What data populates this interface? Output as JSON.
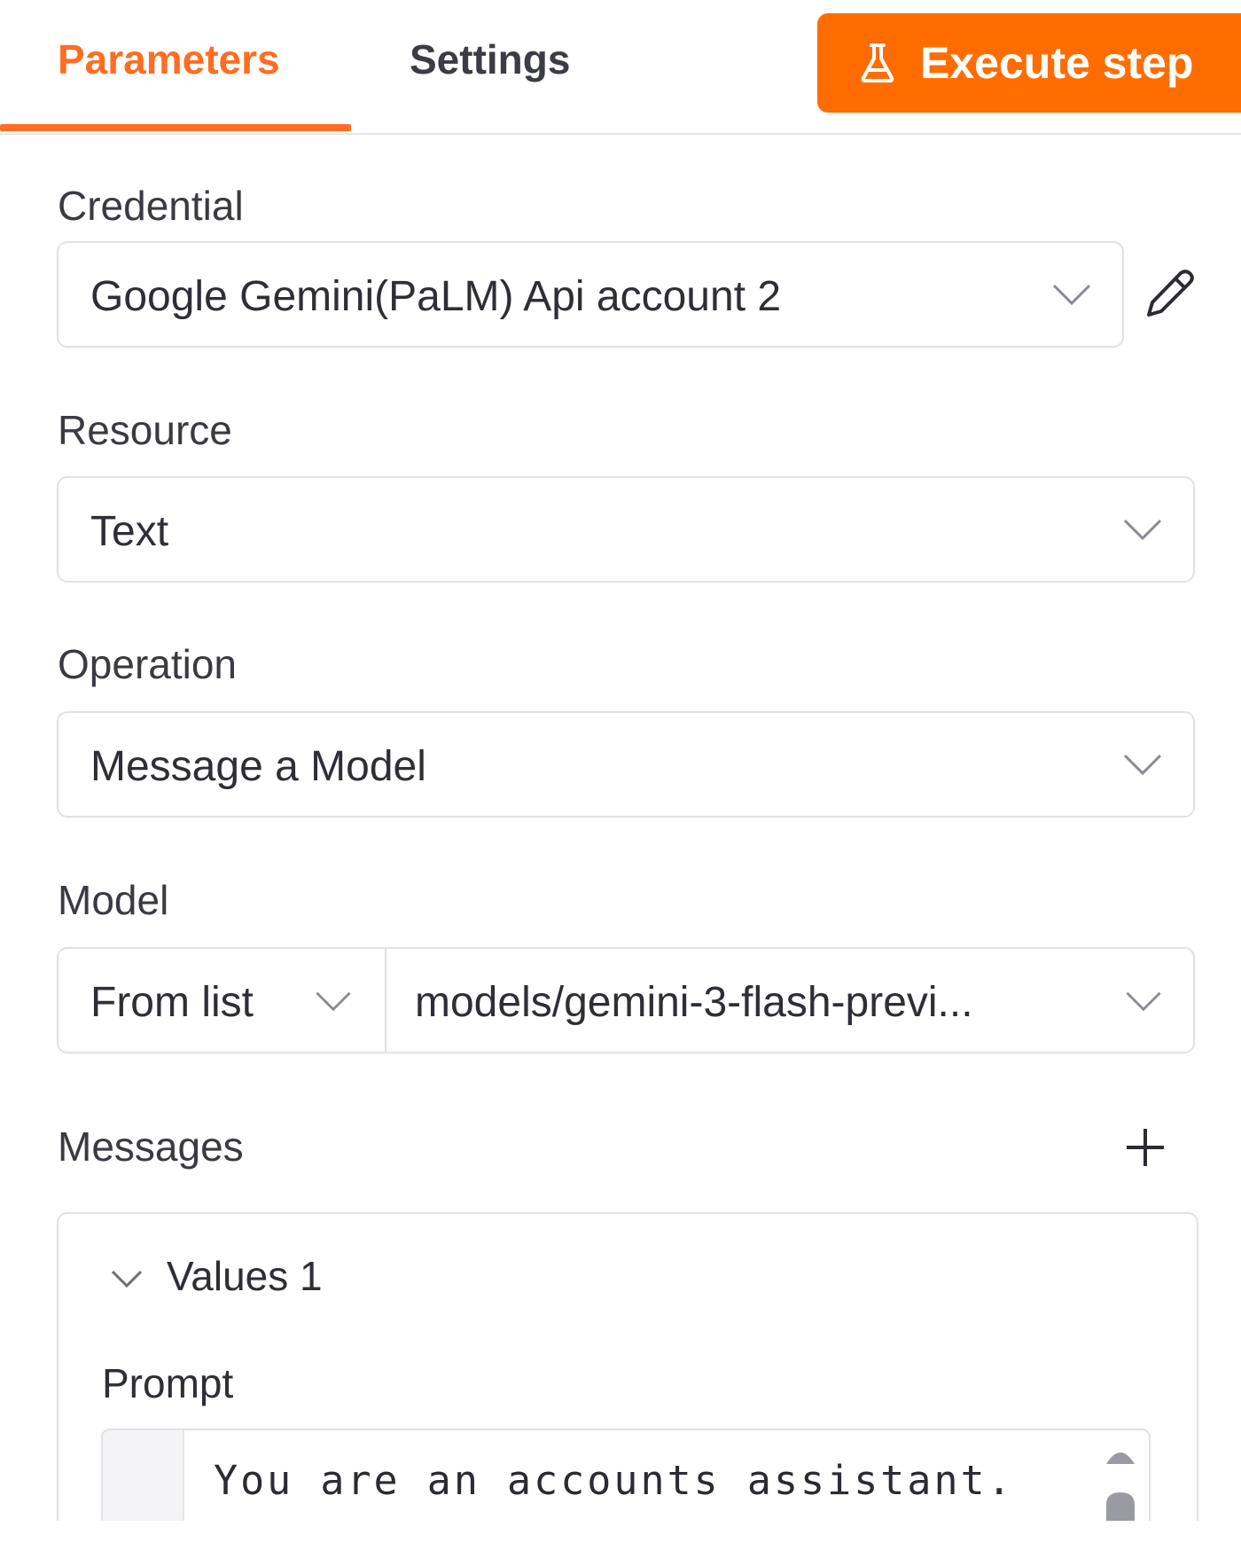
{
  "header": {
    "tabs": [
      {
        "label": "Parameters",
        "active": true
      },
      {
        "label": "Settings",
        "active": false
      }
    ],
    "execute_label": "Execute step"
  },
  "fields": {
    "credential": {
      "label": "Credential",
      "value": "Google Gemini(PaLM) Api account 2"
    },
    "resource": {
      "label": "Resource",
      "value": "Text"
    },
    "operation": {
      "label": "Operation",
      "value": "Message a Model"
    },
    "model": {
      "label": "Model",
      "mode": "From list",
      "value": "models/gemini-3-flash-previ..."
    }
  },
  "messages": {
    "label": "Messages",
    "group_title": "Values 1",
    "prompt_label": "Prompt",
    "prompt_text": "You are an accounts assistant."
  },
  "colors": {
    "accent": "#ff6d22",
    "button": "#ff6d00",
    "border": "#e2e2e6"
  },
  "icons": [
    "flask-icon",
    "chevron-down-icon",
    "pencil-icon",
    "plus-icon",
    "collapse-chevron-icon"
  ]
}
